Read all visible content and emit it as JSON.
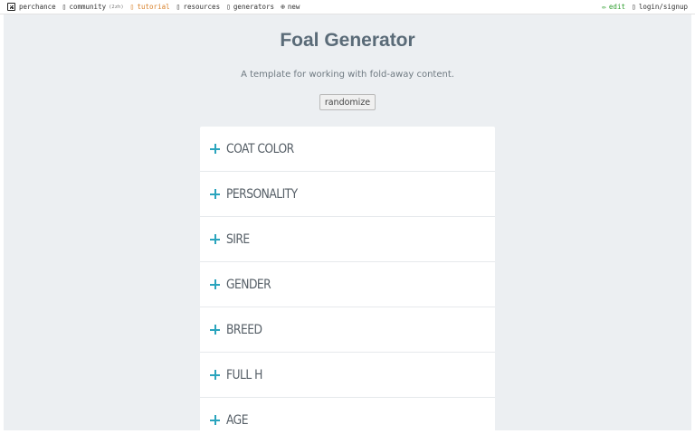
{
  "topbar": {
    "brand": "perchance",
    "community": "community",
    "community_badge": "(2zh)",
    "tutorial": "tutorial",
    "resources": "resources",
    "generators": "generators",
    "new": "new",
    "edit": "edit",
    "login": "login/signup",
    "icons": {
      "brand": "dice-icon",
      "community": "chat-icon",
      "tutorial": "book-icon",
      "resources": "folder-icon",
      "generators": "list-icon",
      "new": "plus-circle-icon",
      "edit": "pencil-icon",
      "login": "user-icon"
    }
  },
  "main": {
    "title": "Foal Generator",
    "subtitle": "A template for working with fold-away content.",
    "randomize_label": "randomize",
    "sections": [
      {
        "label": "COAT COLOR",
        "expanded": false
      },
      {
        "label": "PERSONALITY",
        "expanded": false
      },
      {
        "label": "SIRE",
        "expanded": false
      },
      {
        "label": "GENDER",
        "expanded": false
      },
      {
        "label": "BREED",
        "expanded": false
      },
      {
        "label": "FULL H",
        "expanded": false
      },
      {
        "label": "AGE",
        "expanded": false
      }
    ]
  },
  "colors": {
    "page_background": "#eceff2",
    "title": "#5a6b78",
    "accent_plus": "#2aa4bd",
    "tutorial_link": "#d9822b",
    "edit_link": "#2e9e2e"
  }
}
